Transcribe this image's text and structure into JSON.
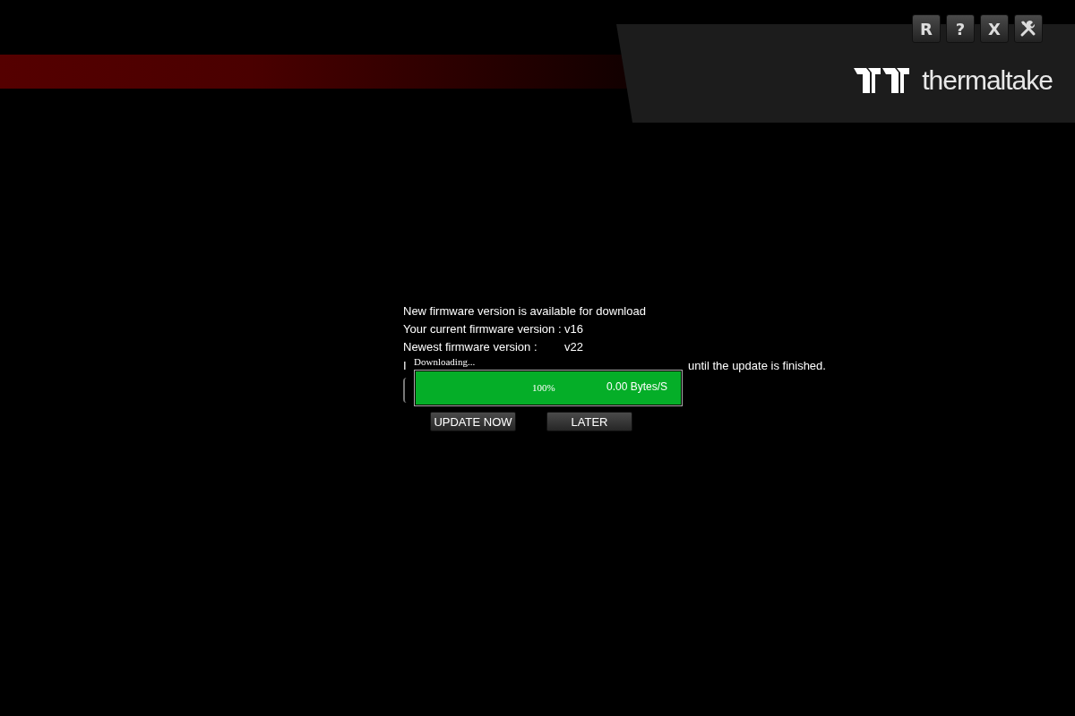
{
  "window_controls": [
    {
      "label": "R",
      "kind": "text"
    },
    {
      "label": "?",
      "kind": "text"
    },
    {
      "label": "X",
      "kind": "text"
    },
    {
      "kind": "tools"
    }
  ],
  "brand": {
    "name": "thermaltake"
  },
  "dialog": {
    "lines": [
      {
        "label": "New firmware version is available for download"
      },
      {
        "label": "Your current firmware version :",
        "value": "v16"
      },
      {
        "label": "Newest firmware version :",
        "value": "v22"
      }
    ],
    "cut_line_start": "I",
    "cut_line_end": "until the update is finished.",
    "buttons": [
      "UPDATE NOW",
      "LATER"
    ]
  },
  "download": {
    "title": "Downloading...",
    "level": 1,
    "percent": "100%",
    "speed": "0.00 Bytes/S"
  }
}
